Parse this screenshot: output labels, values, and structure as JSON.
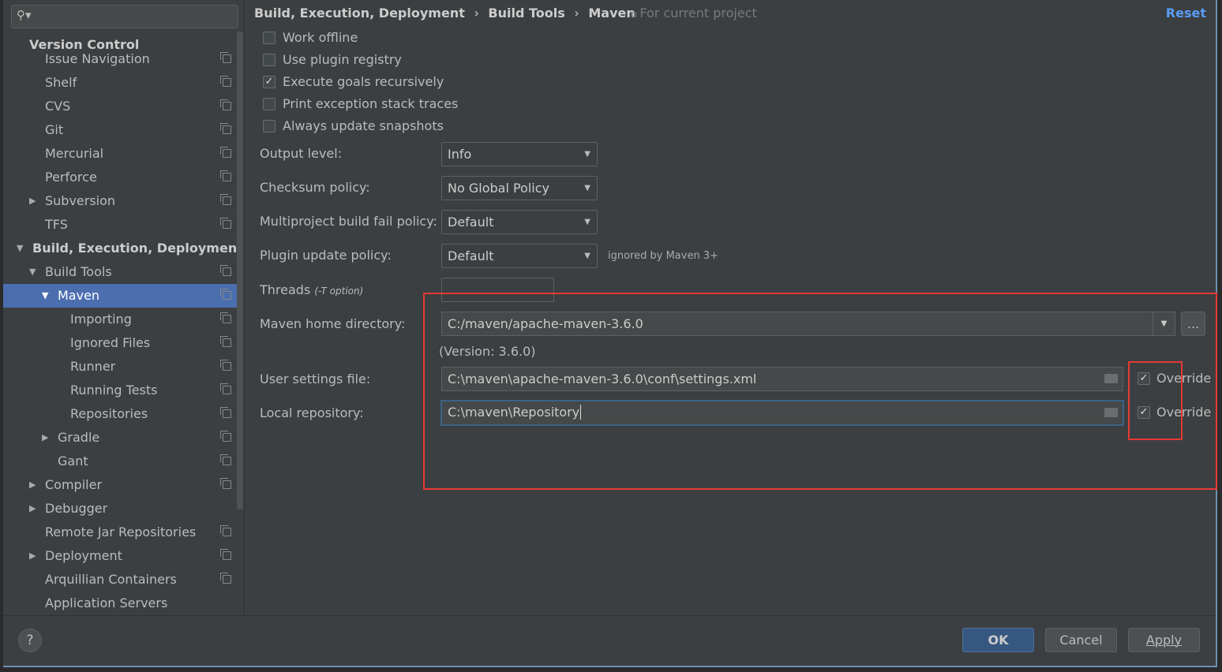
{
  "search": {
    "placeholder": ""
  },
  "sidebar": {
    "header": "Version Control",
    "items": [
      {
        "label": "Issue Navigation",
        "indent": 2,
        "arrow": "",
        "icon": true
      },
      {
        "label": "Shelf",
        "indent": 2,
        "arrow": "",
        "icon": true
      },
      {
        "label": "CVS",
        "indent": 2,
        "arrow": "",
        "icon": true
      },
      {
        "label": "Git",
        "indent": 2,
        "arrow": "",
        "icon": true
      },
      {
        "label": "Mercurial",
        "indent": 2,
        "arrow": "",
        "icon": true
      },
      {
        "label": "Perforce",
        "indent": 2,
        "arrow": "",
        "icon": true
      },
      {
        "label": "Subversion",
        "indent": 2,
        "arrow": "right",
        "icon": true
      },
      {
        "label": "TFS",
        "indent": 2,
        "arrow": "",
        "icon": true
      },
      {
        "label": "Build, Execution, Deployment",
        "indent": 1,
        "arrow": "down",
        "icon": false,
        "bold": true
      },
      {
        "label": "Build Tools",
        "indent": 2,
        "arrow": "down",
        "icon": true
      },
      {
        "label": "Maven",
        "indent": 3,
        "arrow": "down",
        "icon": true,
        "selected": true
      },
      {
        "label": "Importing",
        "indent": 4,
        "arrow": "",
        "icon": true
      },
      {
        "label": "Ignored Files",
        "indent": 4,
        "arrow": "",
        "icon": true
      },
      {
        "label": "Runner",
        "indent": 4,
        "arrow": "",
        "icon": true
      },
      {
        "label": "Running Tests",
        "indent": 4,
        "arrow": "",
        "icon": true
      },
      {
        "label": "Repositories",
        "indent": 4,
        "arrow": "",
        "icon": true
      },
      {
        "label": "Gradle",
        "indent": 3,
        "arrow": "right",
        "icon": true
      },
      {
        "label": "Gant",
        "indent": 3,
        "arrow": "",
        "icon": true
      },
      {
        "label": "Compiler",
        "indent": 2,
        "arrow": "right",
        "icon": true
      },
      {
        "label": "Debugger",
        "indent": 2,
        "arrow": "right",
        "icon": false
      },
      {
        "label": "Remote Jar Repositories",
        "indent": 2,
        "arrow": "",
        "icon": true
      },
      {
        "label": "Deployment",
        "indent": 2,
        "arrow": "right",
        "icon": true
      },
      {
        "label": "Arquillian Containers",
        "indent": 2,
        "arrow": "",
        "icon": true
      },
      {
        "label": "Application Servers",
        "indent": 2,
        "arrow": "",
        "icon": false
      }
    ]
  },
  "breadcrumb": {
    "items": [
      "Build, Execution, Deployment",
      "Build Tools",
      "Maven"
    ],
    "sep": "›",
    "scope": "For current project",
    "reset": "Reset"
  },
  "checkboxes": [
    {
      "label": "Work offline",
      "checked": false
    },
    {
      "label": "Use plugin registry",
      "checked": false
    },
    {
      "label": "Execute goals recursively",
      "checked": true
    },
    {
      "label": "Print exception stack traces",
      "checked": false
    },
    {
      "label": "Always update snapshots",
      "checked": false
    }
  ],
  "form": {
    "output_level": {
      "label": "Output level:",
      "value": "Info"
    },
    "checksum": {
      "label": "Checksum policy:",
      "value": "No Global Policy"
    },
    "multiproject": {
      "label": "Multiproject build fail policy:",
      "value": "Default"
    },
    "plugin_update": {
      "label": "Plugin update policy:",
      "value": "Default",
      "note": "ignored by Maven 3+"
    },
    "threads": {
      "label": "Threads",
      "hint": "(-T option)",
      "value": ""
    },
    "maven_home": {
      "label": "Maven home directory:",
      "value": "C:/maven/apache-maven-3.6.0",
      "browse": "...",
      "version": "(Version: 3.6.0)"
    },
    "user_settings": {
      "label": "User settings file:",
      "value": "C:\\maven\\apache-maven-3.6.0\\conf\\settings.xml",
      "override": "Override",
      "checked": true
    },
    "local_repo": {
      "label": "Local repository:",
      "value": "C:\\maven\\Repository",
      "override": "Override",
      "checked": true
    }
  },
  "footer": {
    "help": "?",
    "ok": "OK",
    "cancel": "Cancel",
    "apply": "Apply"
  },
  "colors": {
    "accent": "#4b6eaf",
    "highlight": "#e53935",
    "link": "#589df6"
  }
}
